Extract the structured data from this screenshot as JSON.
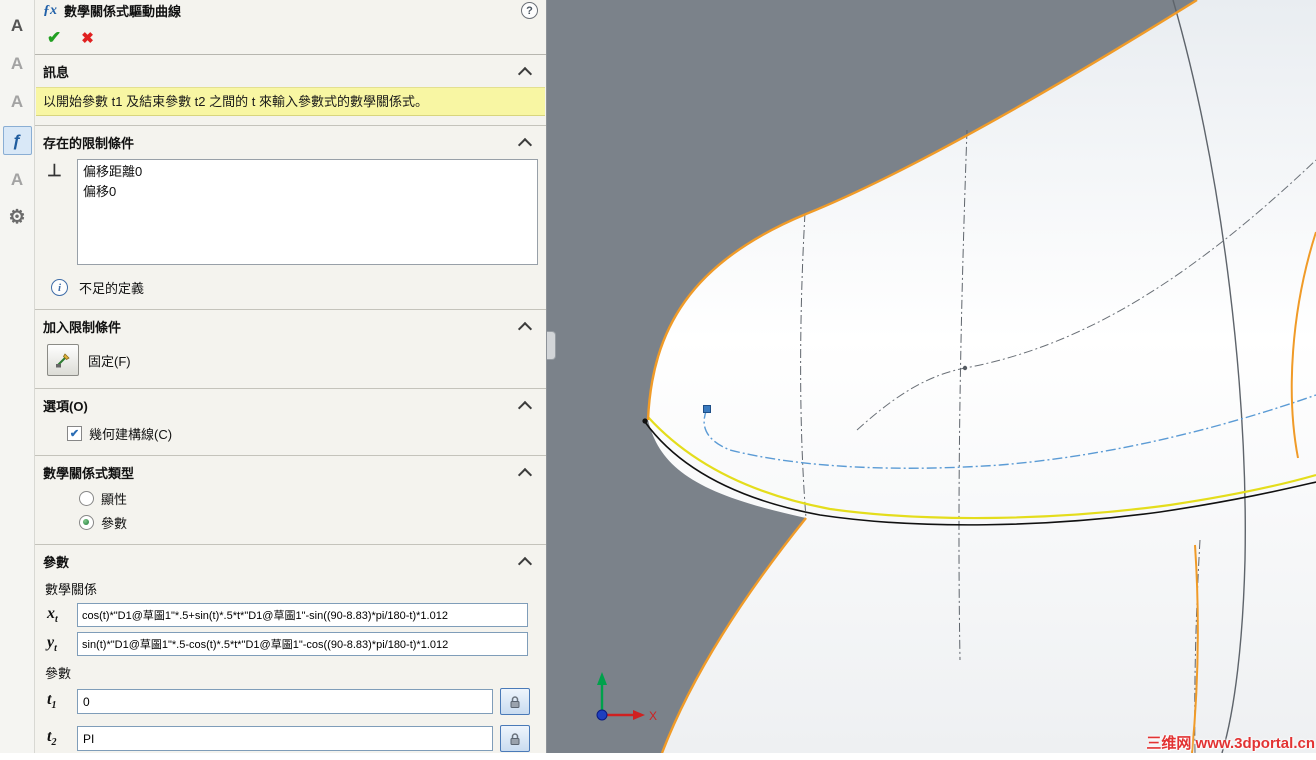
{
  "toolstrip": {
    "icons": [
      {
        "name": "annotation-note-icon",
        "glyph": "A"
      },
      {
        "name": "annotation-text-icon",
        "glyph": "A"
      },
      {
        "name": "annotation-text-disabled-icon",
        "glyph": "A"
      },
      {
        "name": "equation-curve-tool-icon",
        "glyph": "ƒ"
      },
      {
        "name": "annotation-frame-icon",
        "glyph": "A"
      },
      {
        "name": "gear-tool-icon",
        "glyph": "⚙"
      }
    ]
  },
  "panel": {
    "title": "數學關係式驅動曲線",
    "title_icon": "ƒx",
    "help_glyph": "?",
    "ok_glyph": "✔",
    "cancel_glyph": "✖",
    "message": {
      "header": "訊息",
      "text": "以開始參數 t1 及結束參數 t2 之間的 t 來輸入參數式的數學關係式。"
    },
    "existing_relations": {
      "header": "存在的限制條件",
      "relation_icon": "⊥",
      "items": [
        "偏移距離0",
        "偏移0"
      ],
      "status_icon": "i",
      "status": "不足的定義"
    },
    "add_relations": {
      "header": "加入限制條件",
      "fixed_label": "固定(F)"
    },
    "options": {
      "header": "選項(O)",
      "construction_label": "幾何建構線(C)",
      "construction_checked": true,
      "check_glyph": "✔"
    },
    "equation_type": {
      "header": "數學關係式類型",
      "explicit_label": "顯性",
      "explicit_selected": false,
      "parametric_label": "參數",
      "parametric_selected": true
    },
    "parameters": {
      "header": "參數",
      "relation_label": "數學關係",
      "x_base": "x",
      "x_sub": "t",
      "x_value": "cos(t)*\"D1@草圖1\"*.5+sin(t)*.5*t*\"D1@草圖1\"-sin((90-8.83)*pi/180-t)*1.012",
      "y_base": "y",
      "y_sub": "t",
      "y_value": "sin(t)*\"D1@草圖1\"*.5-cos(t)*.5*t*\"D1@草圖1\"-cos((90-8.83)*pi/180-t)*1.012",
      "param_label": "參數",
      "t1_base": "t",
      "t1_sub": "1",
      "t1_value": "0",
      "t2_base": "t",
      "t2_sub": "2",
      "t2_value": "PI"
    }
  },
  "viewport": {
    "triad_x_label": "X",
    "watermark": "三维网 www.3dportal.cn",
    "colors": {
      "background": "#7b828a",
      "edge_orange": "#f09b28",
      "yellow_curve": "#e4dd1c",
      "blue_curve": "#5b9bd5",
      "surface": "#ffffff"
    }
  }
}
